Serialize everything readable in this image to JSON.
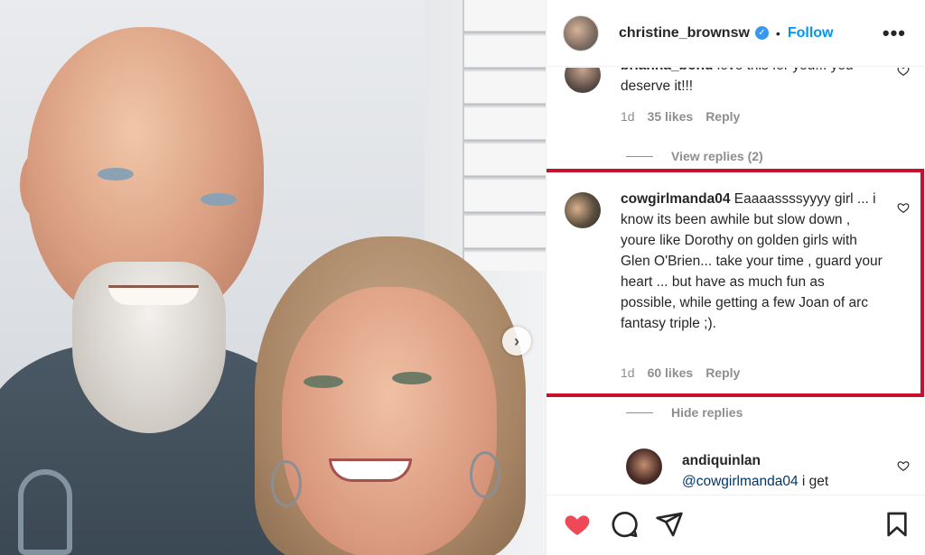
{
  "header": {
    "username": "christine_brownsw",
    "follow_label": "Follow",
    "separator": "•",
    "verified_glyph": "✓",
    "more_glyph": "•••"
  },
  "photo": {
    "next_glyph": "›"
  },
  "comments": [
    {
      "username": "brianna_bond",
      "text": "love this for you... you deserve it!!!",
      "time": "1d",
      "likes": "35 likes",
      "reply": "Reply"
    },
    {
      "username": "cowgirlmanda04",
      "text": "Eaaaassssyyyy girl ... i know its been awhile but slow down , youre like Dorothy on golden girls with Glen O'Brien... take your time , guard your heart ... but have as much fun as possible, while getting a few Joan of arc fantasy triple ;).",
      "time": "1d",
      "likes": "60 likes",
      "reply": "Reply"
    },
    {
      "username": "andiquinlan",
      "mention": "@cowgirlmanda04",
      "text": "i get"
    }
  ],
  "view_replies": "View replies (2)",
  "hide_replies": "Hide replies",
  "icons": {
    "heart_color": "#ed4956",
    "accent": "#0095f6",
    "highlight": "#c8102e"
  }
}
